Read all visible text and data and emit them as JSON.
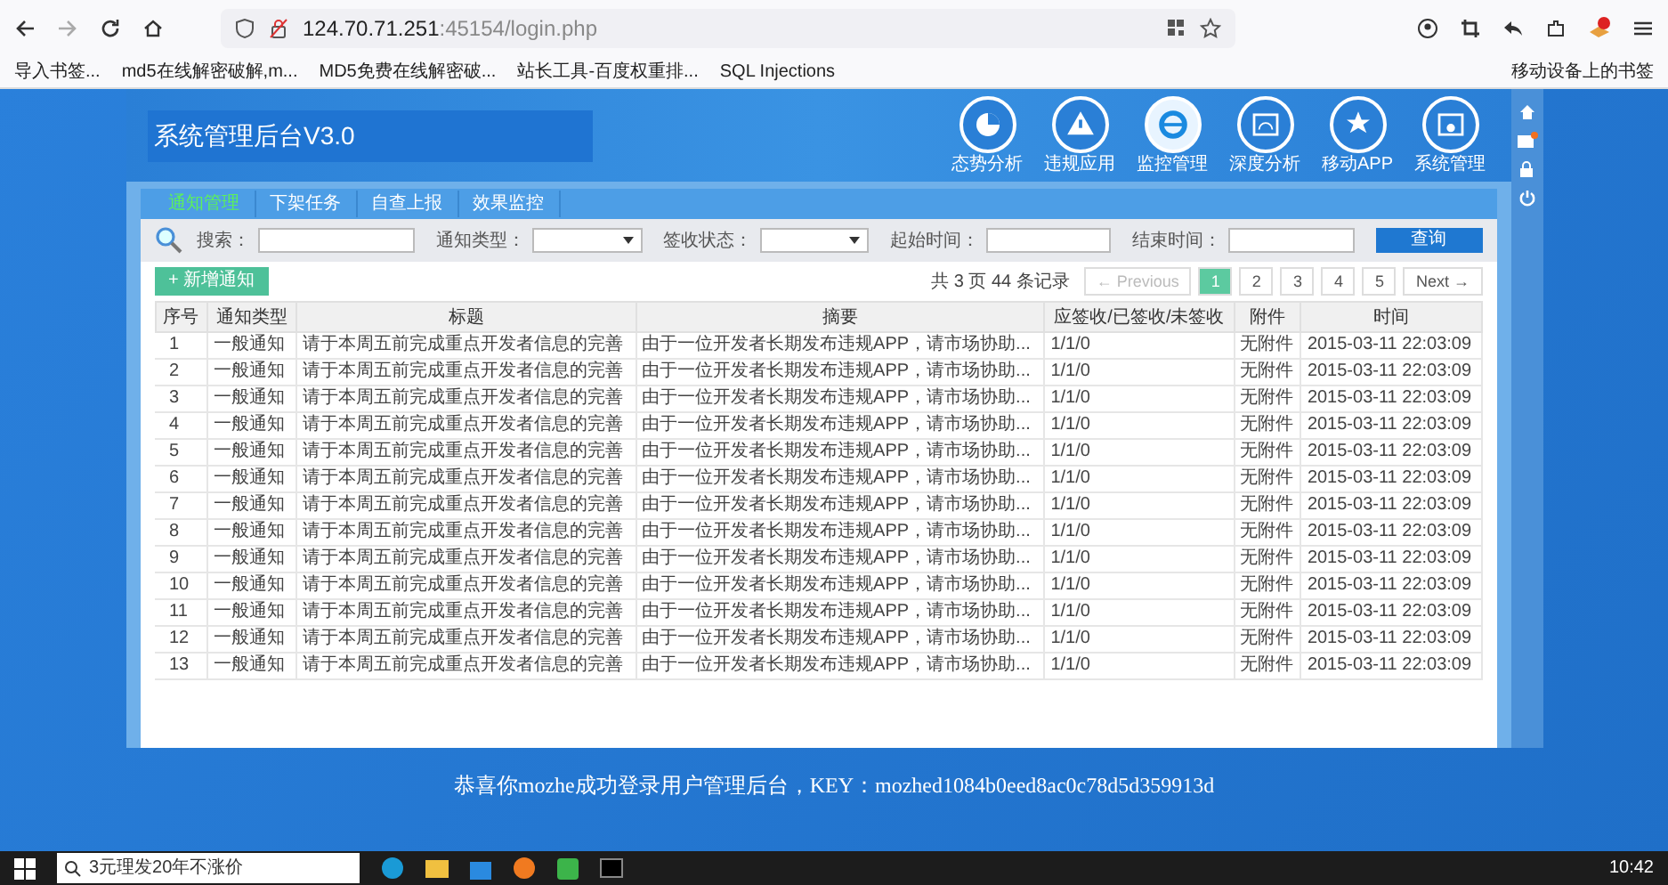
{
  "browser": {
    "url_host": "124.70.71.251",
    "url_rest": ":45154/login.php",
    "bookmarks": [
      "导入书签...",
      "md5在线解密破解,m...",
      "MD5免费在线解密破...",
      "站长工具-百度权重排...",
      "SQL Injections"
    ],
    "mobile_bookmarks": "移动设备上的书签"
  },
  "header": {
    "title": "系统管理后台V3.0",
    "nav": [
      {
        "label": "态势分析",
        "selected": false
      },
      {
        "label": "违规应用",
        "selected": false
      },
      {
        "label": "监控管理",
        "selected": true
      },
      {
        "label": "深度分析",
        "selected": false
      },
      {
        "label": "移动APP",
        "selected": false
      },
      {
        "label": "系统管理",
        "selected": false
      }
    ]
  },
  "tabs": [
    {
      "label": "通知管理",
      "selected": true
    },
    {
      "label": "下架任务",
      "selected": false
    },
    {
      "label": "自查上报",
      "selected": false
    },
    {
      "label": "效果监控",
      "selected": false
    }
  ],
  "filters": {
    "search_label": "搜索：",
    "type_label": "通知类型：",
    "status_label": "签收状态：",
    "start_label": "起始时间：",
    "end_label": "结束时间：",
    "query_button": "查询"
  },
  "toolbar": {
    "add_button": "+ 新增通知",
    "summary": "共 3 页 44 条记录",
    "previous": "← Previous",
    "pages": [
      {
        "label": "1",
        "selected": true
      },
      {
        "label": "2",
        "selected": false
      },
      {
        "label": "3",
        "selected": false
      },
      {
        "label": "4",
        "selected": false
      },
      {
        "label": "5",
        "selected": false
      }
    ],
    "next": "Next →"
  },
  "table": {
    "columns": [
      "序号",
      "通知类型",
      "标题",
      "摘要",
      "应签收/已签收/未签收",
      "附件",
      "时间"
    ],
    "rows": [
      [
        "1",
        "一般通知",
        "请于本周五前完成重点开发者信息的完善",
        "由于一位开发者长期发布违规APP，请市场协助...",
        "1/1/0",
        "无附件",
        "2015-03-11 22:03:09"
      ],
      [
        "2",
        "一般通知",
        "请于本周五前完成重点开发者信息的完善",
        "由于一位开发者长期发布违规APP，请市场协助...",
        "1/1/0",
        "无附件",
        "2015-03-11 22:03:09"
      ],
      [
        "3",
        "一般通知",
        "请于本周五前完成重点开发者信息的完善",
        "由于一位开发者长期发布违规APP，请市场协助...",
        "1/1/0",
        "无附件",
        "2015-03-11 22:03:09"
      ],
      [
        "4",
        "一般通知",
        "请于本周五前完成重点开发者信息的完善",
        "由于一位开发者长期发布违规APP，请市场协助...",
        "1/1/0",
        "无附件",
        "2015-03-11 22:03:09"
      ],
      [
        "5",
        "一般通知",
        "请于本周五前完成重点开发者信息的完善",
        "由于一位开发者长期发布违规APP，请市场协助...",
        "1/1/0",
        "无附件",
        "2015-03-11 22:03:09"
      ],
      [
        "6",
        "一般通知",
        "请于本周五前完成重点开发者信息的完善",
        "由于一位开发者长期发布违规APP，请市场协助...",
        "1/1/0",
        "无附件",
        "2015-03-11 22:03:09"
      ],
      [
        "7",
        "一般通知",
        "请于本周五前完成重点开发者信息的完善",
        "由于一位开发者长期发布违规APP，请市场协助...",
        "1/1/0",
        "无附件",
        "2015-03-11 22:03:09"
      ],
      [
        "8",
        "一般通知",
        "请于本周五前完成重点开发者信息的完善",
        "由于一位开发者长期发布违规APP，请市场协助...",
        "1/1/0",
        "无附件",
        "2015-03-11 22:03:09"
      ],
      [
        "9",
        "一般通知",
        "请于本周五前完成重点开发者信息的完善",
        "由于一位开发者长期发布违规APP，请市场协助...",
        "1/1/0",
        "无附件",
        "2015-03-11 22:03:09"
      ],
      [
        "10",
        "一般通知",
        "请于本周五前完成重点开发者信息的完善",
        "由于一位开发者长期发布违规APP，请市场协助...",
        "1/1/0",
        "无附件",
        "2015-03-11 22:03:09"
      ],
      [
        "11",
        "一般通知",
        "请于本周五前完成重点开发者信息的完善",
        "由于一位开发者长期发布违规APP，请市场协助...",
        "1/1/0",
        "无附件",
        "2015-03-11 22:03:09"
      ],
      [
        "12",
        "一般通知",
        "请于本周五前完成重点开发者信息的完善",
        "由于一位开发者长期发布违规APP，请市场协助...",
        "1/1/0",
        "无附件",
        "2015-03-11 22:03:09"
      ],
      [
        "13",
        "一般通知",
        "请于本周五前完成重点开发者信息的完善",
        "由于一位开发者长期发布违规APP，请市场协助...",
        "1/1/0",
        "无附件",
        "2015-03-11 22:03:09"
      ]
    ]
  },
  "message": "恭喜你mozhe成功登录用户管理后台，KEY：mozhed1084b0eed8ac0c78d5d359913d",
  "taskbar": {
    "search": "3元理发20年不涨价",
    "time": "10:42"
  }
}
